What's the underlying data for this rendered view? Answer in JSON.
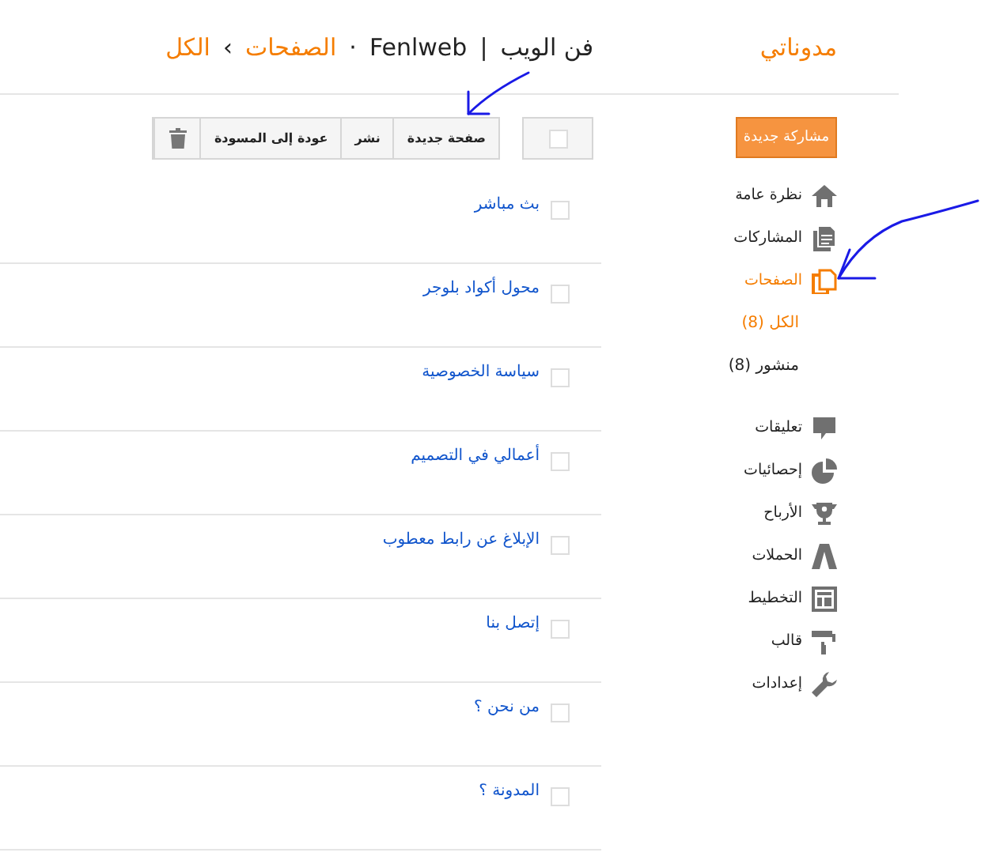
{
  "header": {
    "brand": "مدوناتي",
    "blog_name": "فن الويب",
    "separator": "|",
    "blog_handle": "Fenlweb",
    "dot": "·",
    "breadcrumb": [
      {
        "label": "الصفحات"
      },
      {
        "label": "الكل"
      }
    ],
    "chevron": "›"
  },
  "sidebar": {
    "new_post_button": "مشاركة جديدة",
    "sections": [
      {
        "items": [
          {
            "label": "نظرة عامة",
            "kind": "home",
            "selected": false
          },
          {
            "label": "المشاركات",
            "kind": "posts",
            "selected": false
          },
          {
            "label": "الصفحات",
            "kind": "pages",
            "selected": true,
            "children": [
              {
                "label": "الكل (8)",
                "selected": true
              },
              {
                "label": "منشور (8)",
                "selected": false
              }
            ]
          }
        ]
      },
      {
        "items": [
          {
            "label": "تعليقات",
            "kind": "comments",
            "selected": false
          },
          {
            "label": "إحصائيات",
            "kind": "stats",
            "selected": false
          },
          {
            "label": "الأرباح",
            "kind": "earnings",
            "selected": false
          },
          {
            "label": "الحملات",
            "kind": "campaigns",
            "selected": false
          },
          {
            "label": "التخطيط",
            "kind": "layout",
            "selected": false
          },
          {
            "label": "قالب",
            "kind": "template",
            "selected": false
          },
          {
            "label": "إعدادات",
            "kind": "settings",
            "selected": false
          }
        ]
      }
    ]
  },
  "toolbar": {
    "select_all_checked": false,
    "buttons": [
      "صفحة جديدة",
      "نشر",
      "عودة إلى المسودة"
    ]
  },
  "pages": [
    {
      "title": "بث مباشر",
      "checked": false
    },
    {
      "title": "محول أكواد بلوجر",
      "checked": false
    },
    {
      "title": "سياسة الخصوصية",
      "checked": false
    },
    {
      "title": "أعمالي في التصميم",
      "checked": false
    },
    {
      "title": "الإبلاغ عن رابط معطوب",
      "checked": false
    },
    {
      "title": "إتصل بنا",
      "checked": false
    },
    {
      "title": "من نحن ؟",
      "checked": false
    },
    {
      "title": "المدونة ؟",
      "checked": false
    }
  ]
}
